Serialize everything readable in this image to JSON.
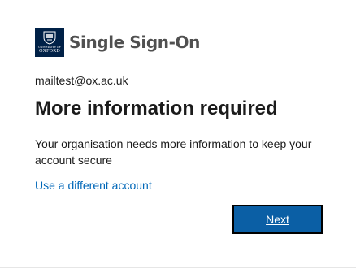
{
  "logo": {
    "crest_line1": "UNIVERSITY OF",
    "crest_line2": "OXFORD",
    "brand_text": "Single Sign-On"
  },
  "account": {
    "email": "mailtest@ox.ac.uk"
  },
  "main": {
    "title": "More information required",
    "description": "Your organisation needs more information to keep your account secure",
    "different_account_link": "Use a different account",
    "next_label": "Next"
  },
  "colors": {
    "crest_bg": "#002147",
    "link": "#0067b8",
    "button_bg": "#0b5fa5"
  }
}
